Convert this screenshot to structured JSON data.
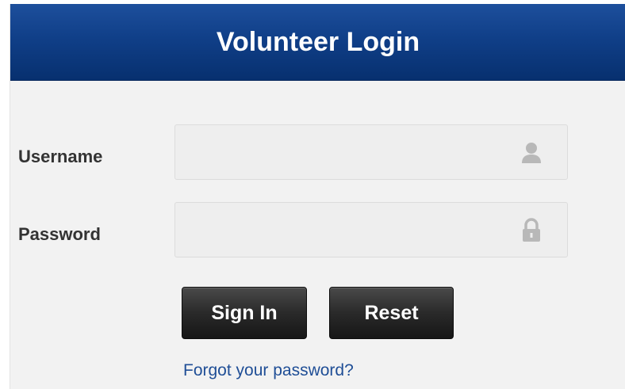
{
  "header": {
    "title": "Volunteer Login"
  },
  "form": {
    "username": {
      "label": "Username",
      "value": "",
      "placeholder": "",
      "icon": "user-icon"
    },
    "password": {
      "label": "Password",
      "value": "",
      "placeholder": "",
      "icon": "lock-icon"
    },
    "sign_in_label": "Sign In",
    "reset_label": "Reset",
    "forgot_link": "Forgot your password?"
  },
  "colors": {
    "header_blue": "#103f88",
    "button_dark": "#2a2a2a",
    "link_blue": "#1f4e96",
    "panel_bg": "#f2f2f2"
  }
}
